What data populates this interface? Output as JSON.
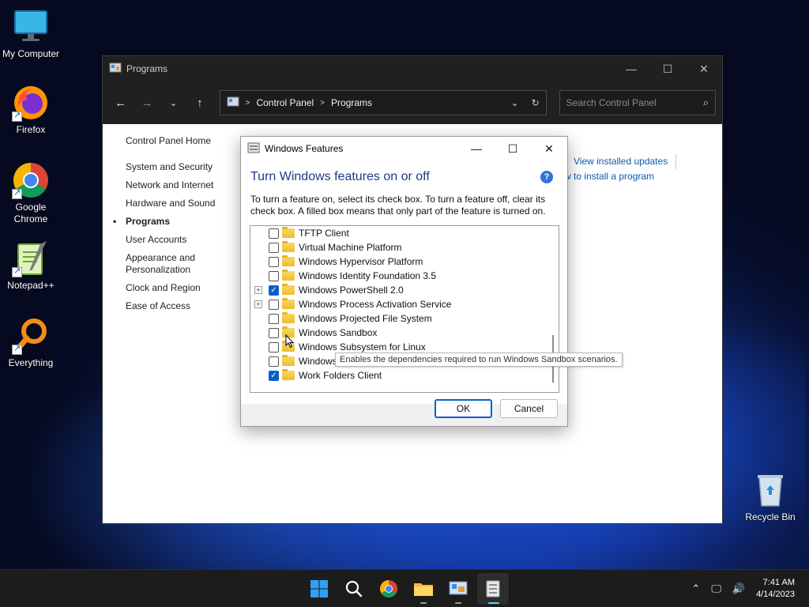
{
  "desktop": {
    "icons": [
      {
        "label": "My Computer",
        "icon": "monitor-icon"
      },
      {
        "label": "Firefox",
        "icon": "firefox-icon"
      },
      {
        "label": "Google Chrome",
        "icon": "chrome-icon"
      },
      {
        "label": "Notepad++",
        "icon": "notepadpp-icon"
      },
      {
        "label": "Everything",
        "icon": "everything-search-icon"
      },
      {
        "label": "Recycle Bin",
        "icon": "recycle-bin-icon"
      }
    ]
  },
  "control_panel": {
    "title": "Programs",
    "breadcrumb": [
      "Control Panel",
      "Programs"
    ],
    "search_placeholder": "Search Control Panel",
    "sidebar": {
      "home": "Control Panel Home",
      "items": [
        "System and Security",
        "Network and Internet",
        "Hardware and Sound",
        "Programs",
        "User Accounts",
        "Appearance and Personalization",
        "Clock and Region",
        "Ease of Access"
      ],
      "active": "Programs"
    },
    "links": {
      "view_updates": "View installed updates",
      "install_program": "w to install a program"
    }
  },
  "windows_features": {
    "title": "Windows Features",
    "heading": "Turn Windows features on or off",
    "description": "To turn a feature on, select its check box. To turn a feature off, clear its check box. A filled box means that only part of the feature is turned on.",
    "features": [
      {
        "name": "TFTP Client",
        "checked": false,
        "expandable": false
      },
      {
        "name": "Virtual Machine Platform",
        "checked": false,
        "expandable": false
      },
      {
        "name": "Windows Hypervisor Platform",
        "checked": false,
        "expandable": false
      },
      {
        "name": "Windows Identity Foundation 3.5",
        "checked": false,
        "expandable": false
      },
      {
        "name": "Windows PowerShell 2.0",
        "checked": true,
        "expandable": true
      },
      {
        "name": "Windows Process Activation Service",
        "checked": false,
        "expandable": true
      },
      {
        "name": "Windows Projected File System",
        "checked": false,
        "expandable": false
      },
      {
        "name": "Windows Sandbox",
        "checked": false,
        "expandable": false
      },
      {
        "name": "Windows Subsystem for Linux",
        "checked": false,
        "expandable": false
      },
      {
        "name": "Windows",
        "checked": false,
        "expandable": false
      },
      {
        "name": "Work Folders Client",
        "checked": true,
        "expandable": false
      }
    ],
    "tooltip": "Enables the dependencies required to run Windows Sandbox scenarios.",
    "ok_label": "OK",
    "cancel_label": "Cancel"
  },
  "taskbar": {
    "apps": [
      "start-icon",
      "search-icon",
      "chrome-icon",
      "file-explorer-icon",
      "control-panel-icon",
      "windows-features-icon"
    ],
    "time": "7:41 AM",
    "date": "4/14/2023"
  },
  "colors": {
    "accent": "#0a5fc8",
    "link": "#0b5cad",
    "heading": "#1e3a8a"
  }
}
